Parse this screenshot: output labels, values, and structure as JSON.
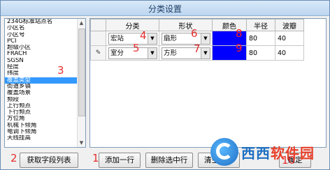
{
  "window": {
    "title": "分类设置"
  },
  "field_list": {
    "items": [
      "234G标准站点名",
      "小区名",
      "小区号",
      "PCI",
      "超级小区",
      "FRACH",
      "SGSN",
      "经度",
      "纬度",
      "覆盖类型",
      "街道乡镇",
      "覆盖场景",
      "频段",
      "上行频点",
      "下行频点",
      "方位角",
      "机械下倾角",
      "电调下倾角",
      "天线挂高"
    ],
    "selected_index": 9
  },
  "grid": {
    "headers": [
      "分类",
      "形状",
      "颜色",
      "半径",
      "波瓣"
    ],
    "rows": [
      {
        "indicator": "",
        "category": "宏站",
        "shape": "扇形",
        "color": "#0000ff",
        "radius": "80",
        "lobe": "40"
      },
      {
        "indicator": "✎",
        "category": "室分",
        "shape": "方形",
        "color": "#0000ff",
        "radius": "80",
        "lobe": "40"
      }
    ]
  },
  "buttons": {
    "get_fields": "获取字段列表",
    "add_row": "添加一行",
    "delete_row": "删除选中行",
    "clear_all": "清空所有",
    "confirm": "确定"
  },
  "annotations": [
    "1",
    "2",
    "3",
    "4",
    "5",
    "6",
    "7",
    "8",
    "9",
    "10"
  ],
  "watermark": {
    "brand_a": "西西",
    "brand_b": "软件园"
  }
}
